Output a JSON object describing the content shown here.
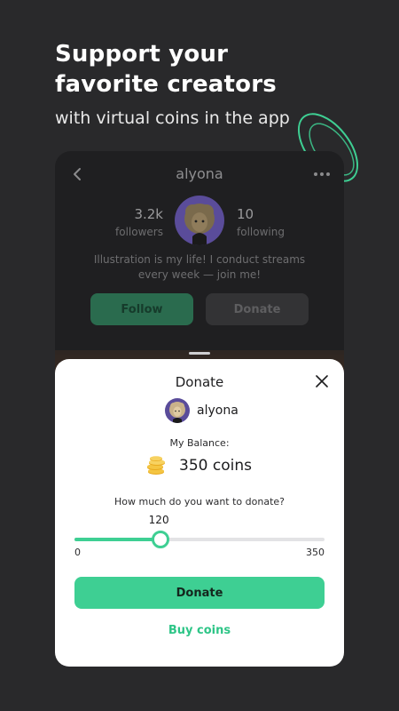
{
  "promo": {
    "headline_line1": "Support your",
    "headline_line2": "favorite creators",
    "subline": "with virtual coins in the app"
  },
  "profile": {
    "username": "alyona",
    "followers_count": "3.2k",
    "followers_label": "followers",
    "following_count": "10",
    "following_label": "following",
    "bio_line1": "Illustration is my life! I conduct streams",
    "bio_line2": "every week — join me!",
    "follow_label": "Follow",
    "donate_label": "Donate"
  },
  "donate_sheet": {
    "title": "Donate",
    "recipient": "alyona",
    "balance_label": "My Balance:",
    "balance_value": "350 coins",
    "question": "How much do you want to donate?",
    "slider": {
      "value": "120",
      "min_label": "0",
      "max_label": "350",
      "min": 0,
      "max": 350,
      "current": 120
    },
    "donate_button": "Donate",
    "buy_coins": "Buy coins"
  },
  "colors": {
    "accent": "#3ecf93",
    "background": "#29292b",
    "sheet": "#ffffff"
  },
  "icons": [
    "back-arrow-icon",
    "more-dots-icon",
    "close-icon",
    "coins-icon",
    "decorative-rings"
  ]
}
